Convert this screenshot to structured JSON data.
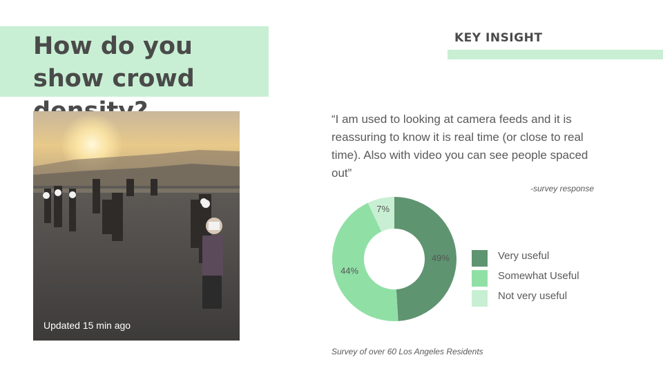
{
  "slide": {
    "title": "How do you show crowd density?",
    "key_insight_heading": "KEY INSIGHT",
    "photo_caption": "Updated 15 min ago",
    "quote": "“I am used to looking at camera feeds and it is reassuring to know it is real time (or close to real time). Also with video you can see people spaced out”",
    "attribution": "-survey response",
    "footnote": "Survey of over 60 Los Angeles Residents"
  },
  "colors": {
    "accent_band": "#c8efd3",
    "very_useful": "#5f9470",
    "somewhat_useful": "#90e0a6",
    "not_very_useful": "#c8efd3"
  },
  "icons": {
    "photo": "crowd-observatory-photo"
  },
  "chart_data": {
    "type": "pie",
    "subtype": "donut",
    "title": "",
    "legend_position": "right",
    "slices": [
      {
        "label": "Very useful",
        "value": 49,
        "display": "49%",
        "color": "#5f9470"
      },
      {
        "label": "Somewhat Useful",
        "value": 44,
        "display": "44%",
        "color": "#90e0a6"
      },
      {
        "label": "Not very useful",
        "value": 7,
        "display": "7%",
        "color": "#c8efd3"
      }
    ]
  }
}
